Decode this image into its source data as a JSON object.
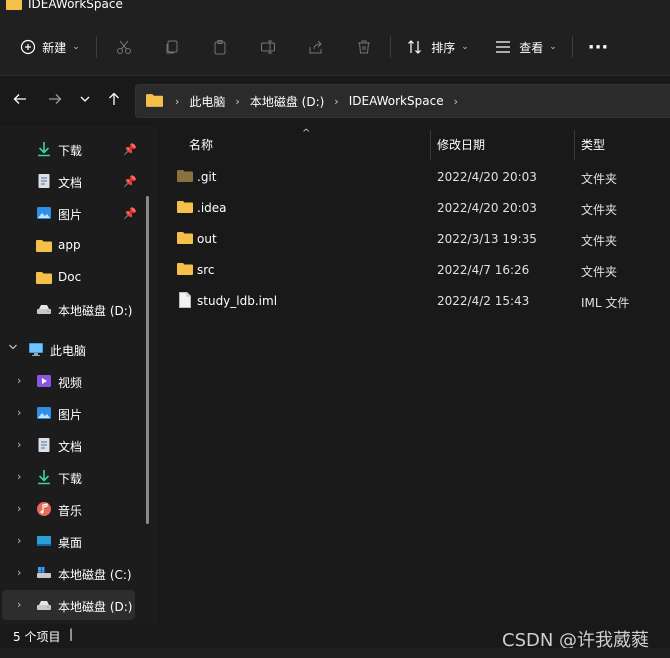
{
  "window": {
    "title": "IDEAWorkSpace"
  },
  "toolbar": {
    "new_label": "新建",
    "sort_label": "排序",
    "view_label": "查看",
    "more": "···"
  },
  "address": {
    "crumbs": [
      "此电脑",
      "本地磁盘 (D:)",
      "IDEAWorkSpace"
    ]
  },
  "sidebar": {
    "quick": [
      {
        "label": "下载",
        "icon": "download-icon",
        "pinned": true
      },
      {
        "label": "文档",
        "icon": "document-icon",
        "pinned": true
      },
      {
        "label": "图片",
        "icon": "picture-icon",
        "pinned": true
      },
      {
        "label": "app",
        "icon": "folder-icon",
        "pinned": false
      },
      {
        "label": "Doc",
        "icon": "folder-icon",
        "pinned": false
      },
      {
        "label": "本地磁盘 (D:)",
        "icon": "drive-icon",
        "pinned": false
      }
    ],
    "thispc": {
      "label": "此电脑",
      "icon": "computer-icon"
    },
    "pc_items": [
      {
        "label": "视频",
        "icon": "video-icon"
      },
      {
        "label": "图片",
        "icon": "picture-icon"
      },
      {
        "label": "文档",
        "icon": "document-icon"
      },
      {
        "label": "下载",
        "icon": "download-icon"
      },
      {
        "label": "音乐",
        "icon": "music-icon"
      },
      {
        "label": "桌面",
        "icon": "desktop-icon"
      },
      {
        "label": "本地磁盘 (C:)",
        "icon": "windows-drive-icon"
      },
      {
        "label": "本地磁盘 (D:)",
        "icon": "drive-icon"
      }
    ]
  },
  "columns": {
    "name": "名称",
    "date": "修改日期",
    "type": "类型"
  },
  "files": [
    {
      "name": ".git",
      "date": "2022/4/20 20:03",
      "type": "文件夹",
      "kind": "folder-dim"
    },
    {
      "name": ".idea",
      "date": "2022/4/20 20:03",
      "type": "文件夹",
      "kind": "folder"
    },
    {
      "name": "out",
      "date": "2022/3/13 19:35",
      "type": "文件夹",
      "kind": "folder"
    },
    {
      "name": "src",
      "date": "2022/4/7 16:26",
      "type": "文件夹",
      "kind": "folder"
    },
    {
      "name": "study_ldb.iml",
      "date": "2022/4/2 15:43",
      "type": "IML 文件",
      "kind": "file"
    }
  ],
  "status": {
    "count": "5 个项目",
    "cursor": "|"
  },
  "watermark": "CSDN @许我葳蕤",
  "colors": {
    "folder": "#f5c04a",
    "folder_dim": "#8a7240",
    "accent": "#4cc2ff"
  }
}
